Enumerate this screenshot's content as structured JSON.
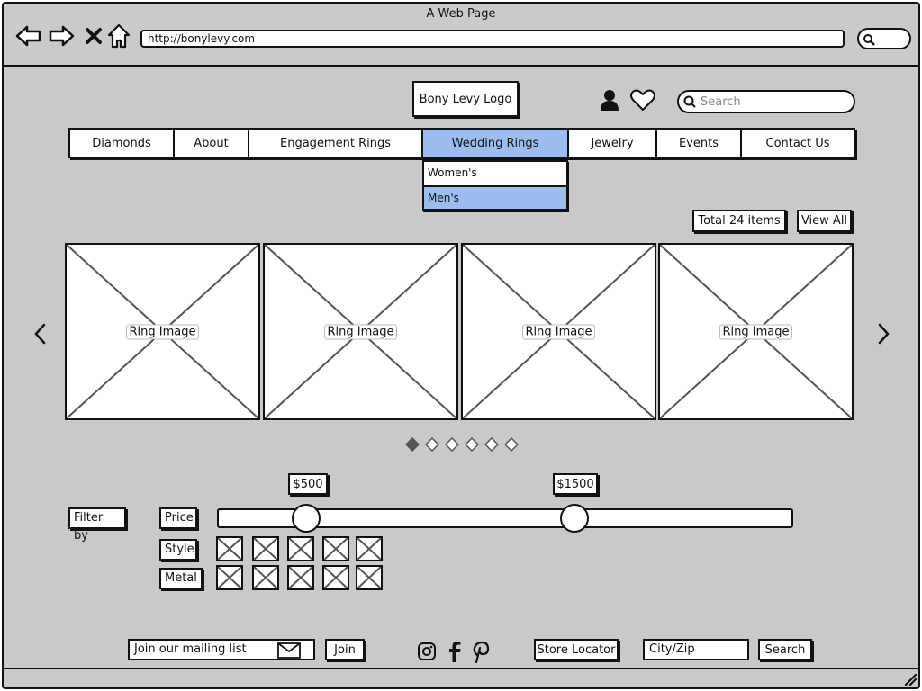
{
  "window": {
    "title": "A Web Page",
    "url": "http://bonylevy.com"
  },
  "header": {
    "logo": "Bony Levy Logo",
    "search_placeholder": "Search"
  },
  "menu": {
    "items": [
      {
        "label": "Diamonds",
        "active": false
      },
      {
        "label": "About",
        "active": false
      },
      {
        "label": "Engagement Rings",
        "active": false
      },
      {
        "label": "Wedding Rings",
        "active": true
      },
      {
        "label": "Jewelry",
        "active": false
      },
      {
        "label": "Events",
        "active": false
      },
      {
        "label": "Contact Us",
        "active": false
      }
    ],
    "dropdown": [
      {
        "label": "Women's",
        "active": false
      },
      {
        "label": "Men's",
        "active": true
      }
    ]
  },
  "listing": {
    "total": "Total 24 items",
    "view_all": "View All"
  },
  "carousel": {
    "cards": [
      {
        "label": "Ring Image"
      },
      {
        "label": "Ring Image"
      },
      {
        "label": "Ring Image"
      },
      {
        "label": "Ring Image"
      }
    ],
    "page_count": 6,
    "active_page": 1
  },
  "filters": {
    "title": "Filter by",
    "price": {
      "label": "Price",
      "min_label": "$500",
      "max_label": "$1500"
    },
    "style": {
      "label": "Style",
      "option_count": 5
    },
    "metal": {
      "label": "Metal",
      "option_count": 5
    }
  },
  "footer": {
    "mailing_placeholder": "Join our mailing list",
    "join": "Join",
    "store_locator": "Store Locator",
    "city_zip_placeholder": "City/Zip",
    "search": "Search",
    "social": [
      "instagram-icon",
      "facebook-icon",
      "pinterest-icon"
    ]
  },
  "colors": {
    "background": "#c9c9c9",
    "active_blue": "#9bbdf0"
  }
}
